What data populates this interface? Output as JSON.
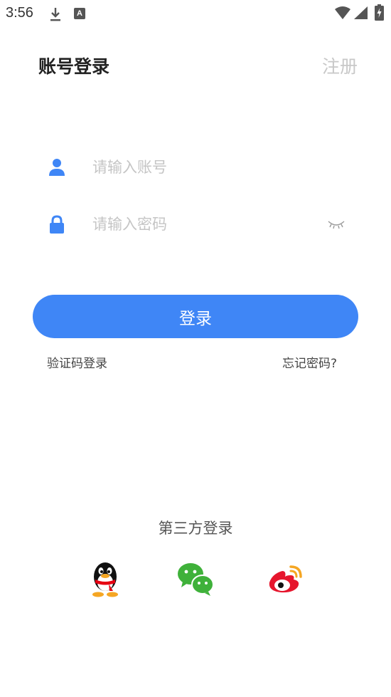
{
  "status_bar": {
    "time": "3:56"
  },
  "header": {
    "title": "账号登录",
    "register_label": "注册"
  },
  "form": {
    "account_placeholder": "请输入账号",
    "password_placeholder": "请输入密码"
  },
  "login_button_label": "登录",
  "links": {
    "sms_login": "验证码登录",
    "forgot_password": "忘记密码?"
  },
  "third_party": {
    "title": "第三方登录",
    "providers": [
      "qq-icon",
      "wechat-icon",
      "weibo-icon"
    ]
  },
  "colors": {
    "primary": "#3f86f6",
    "register_text": "#c8c8c8",
    "placeholder": "#c5c5c5"
  }
}
